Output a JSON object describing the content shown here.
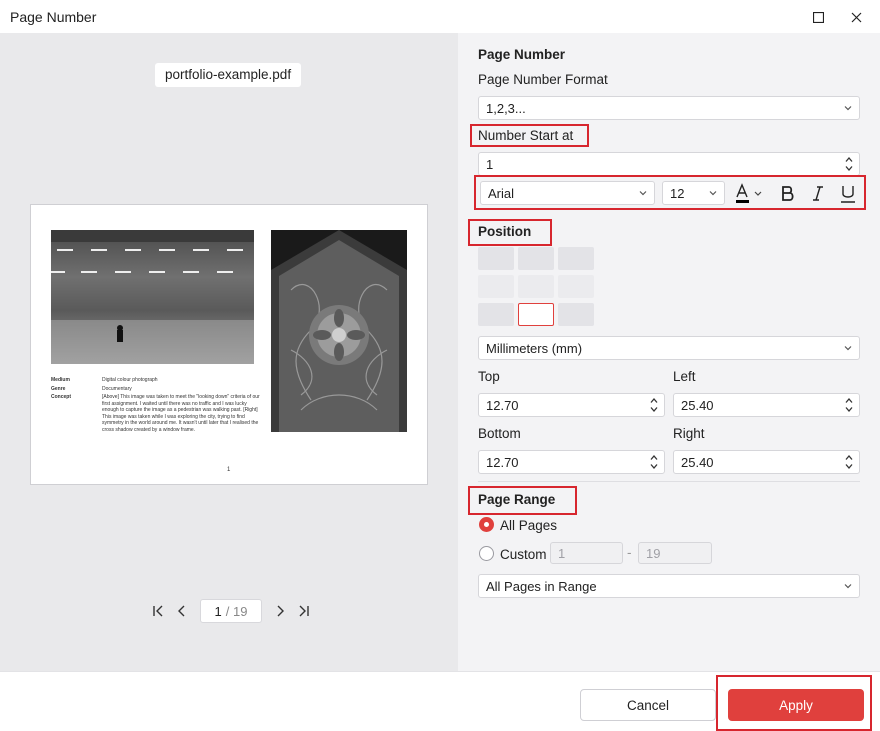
{
  "window": {
    "title": "Page Number"
  },
  "preview": {
    "file_name": "portfolio-example.pdf",
    "document": {
      "meta": [
        {
          "key": "Medium",
          "value": "Digital colour photograph"
        },
        {
          "key": "Genre",
          "value": "Documentary"
        },
        {
          "key": "Concept",
          "value": "[Above] This image was taken to meet the \"looking down\" criteria of our first assignment. I waited until there was no traffic and I was lucky enough to capture the image as a pedestrian was walking past. [Right] This image was taken while I was exploring the city, trying to find symmetry in the world around me. It wasn't until later that I realised the cross shadow created by a window frame."
        }
      ],
      "page_number": "1"
    },
    "pager": {
      "current": "1",
      "total": "/ 19"
    }
  },
  "settings": {
    "section_title": "Page Number",
    "format_label": "Page Number Format",
    "format_value": "1,2,3...",
    "start_label": "Number Start at",
    "start_value": "1",
    "font": "Arial",
    "font_size": "12",
    "position_label": "Position",
    "unit": "Millimeters (mm)",
    "top_label": "Top",
    "top_value": "12.70",
    "left_label": "Left",
    "left_value": "25.40",
    "bottom_label": "Bottom",
    "bottom_value": "12.70",
    "right_label": "Right",
    "right_value": "25.40",
    "range_label": "Page Range",
    "all_pages_label": "All Pages",
    "custom_label": "Custom",
    "custom_from": "1",
    "custom_dash": "-",
    "custom_to": "19",
    "subset": "All Pages in Range"
  },
  "footer": {
    "cancel": "Cancel",
    "apply": "Apply"
  },
  "colors": {
    "accent": "#e0403d",
    "highlight_box": "#d7262e",
    "font_color": "#000000"
  }
}
